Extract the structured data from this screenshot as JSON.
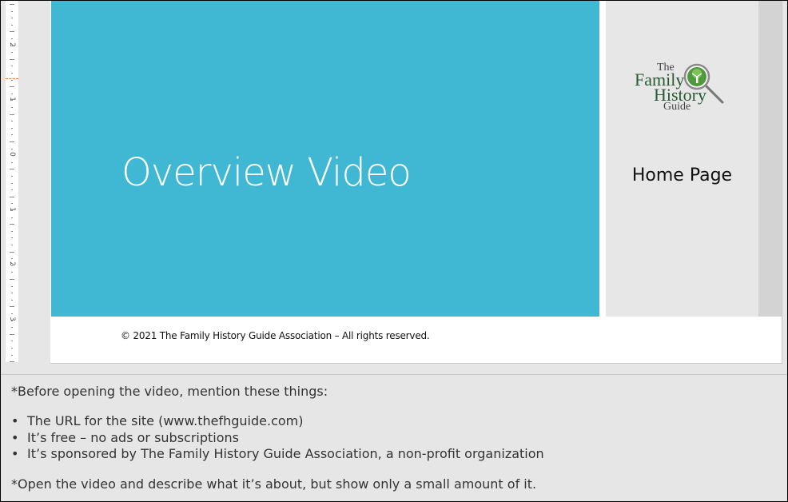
{
  "slide": {
    "title": "Overview Video",
    "side_label": "Home Page",
    "copyright": "© 2021 The Family History Guide Association – All rights reserved.",
    "logo": {
      "line1": "The",
      "line2": "Family",
      "line3": "History",
      "line4": "Guide",
      "icon": "magnifier-tree-icon"
    },
    "colors": {
      "title_panel": "#40b8d3",
      "side_panel": "#e7e7e7",
      "logo_green": "#2a5a33"
    }
  },
  "ruler": {
    "numbers": [
      "2",
      "1",
      "0",
      "1",
      "2",
      "3"
    ]
  },
  "notes": {
    "intro": "*Before opening the video, mention these things:",
    "bullets": [
      "The URL for the site (www.thefhguide.com)",
      "It’s free – no ads or subscriptions",
      "It’s sponsored by The Family History Guide Association, a non-profit organization"
    ],
    "outro": "*Open the video and describe what it’s about, but show only a small amount of it."
  }
}
